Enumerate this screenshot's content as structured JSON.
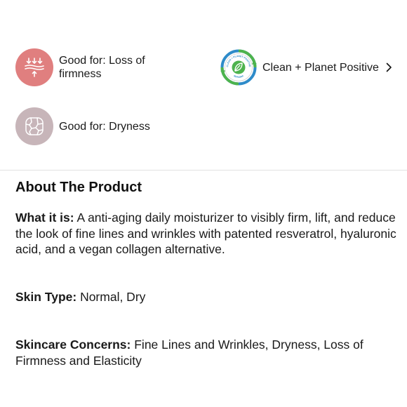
{
  "badges": [
    {
      "label": "Good for: Loss of firmness",
      "icon": "firmness-arrows-icon",
      "color": "#e07f7f"
    },
    {
      "label": "Good for: Dryness",
      "icon": "dry-skin-cracks-icon",
      "color": "#c7b5b9"
    }
  ],
  "clean_badge": {
    "label": "Clean + Planet Positive",
    "icon": "clean-planet-leaf-icon",
    "seal_top_text": "CLEAN + PLANET POSITIVE",
    "seal_bottom_text": "SEPHORA",
    "colors": {
      "ring_blue": "#2e8bc9",
      "ring_green": "#4db34d"
    }
  },
  "about": {
    "title": "About The Product",
    "what_label": "What it is:",
    "what_text": " A anti-aging daily moisturizer to visibly firm, lift, and reduce the look of fine lines and wrinkles with patented resveratrol, hyaluronic acid, and a vegan collagen alternative.",
    "skin_label": "Skin Type:",
    "skin_text": " Normal, Dry",
    "concerns_label": "Skincare Concerns:",
    "concerns_text": " Fine Lines and Wrinkles, Dryness, Loss of Firmness and Elasticity"
  }
}
